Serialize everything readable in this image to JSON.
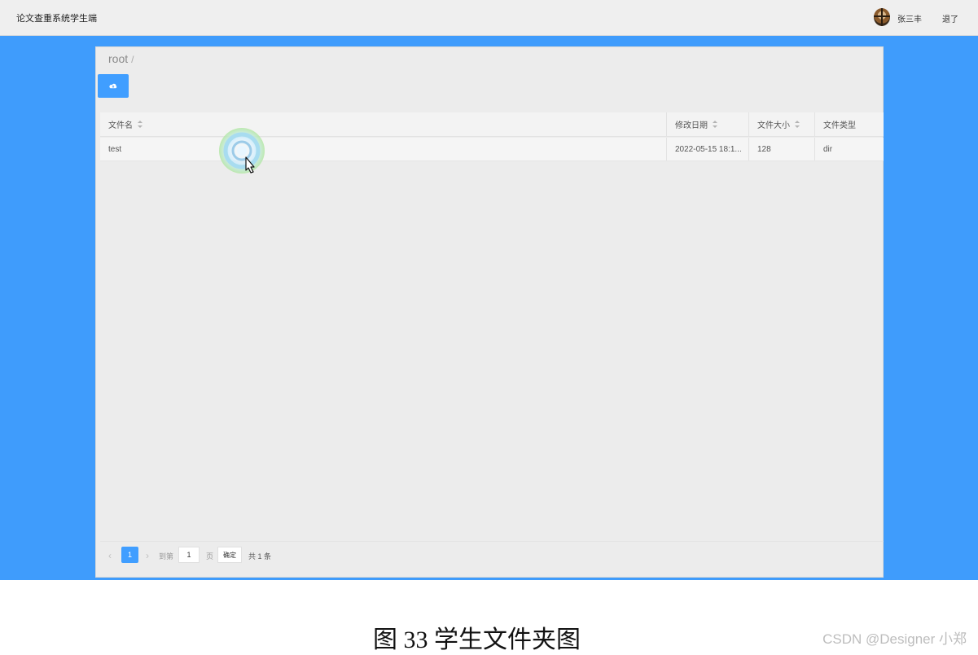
{
  "header": {
    "app_title": "论文查重系统学生端",
    "user_name": "张三丰",
    "logout_label": "退了"
  },
  "breadcrumb": {
    "path": "root",
    "separator": "/"
  },
  "toolbar": {
    "upload_icon": "cloud-upload-icon"
  },
  "table": {
    "columns": [
      "文件名",
      "修改日期",
      "文件大小",
      "文件类型"
    ],
    "rows": [
      {
        "name": "test",
        "date": "2022-05-15 18:1...",
        "size": "128",
        "type": "dir"
      }
    ]
  },
  "pagination": {
    "prev": "‹",
    "current_page": "1",
    "next": "›",
    "goto_label": "到第",
    "goto_value": "1",
    "page_unit": "页",
    "confirm_label": "确定",
    "total_label": "共 1 条"
  },
  "caption": "图 33 学生文件夹图",
  "watermark": "CSDN @Designer 小郑",
  "colors": {
    "accent": "#409eff",
    "frame_background": "#3f9cfc",
    "panel_background": "#ececec"
  }
}
